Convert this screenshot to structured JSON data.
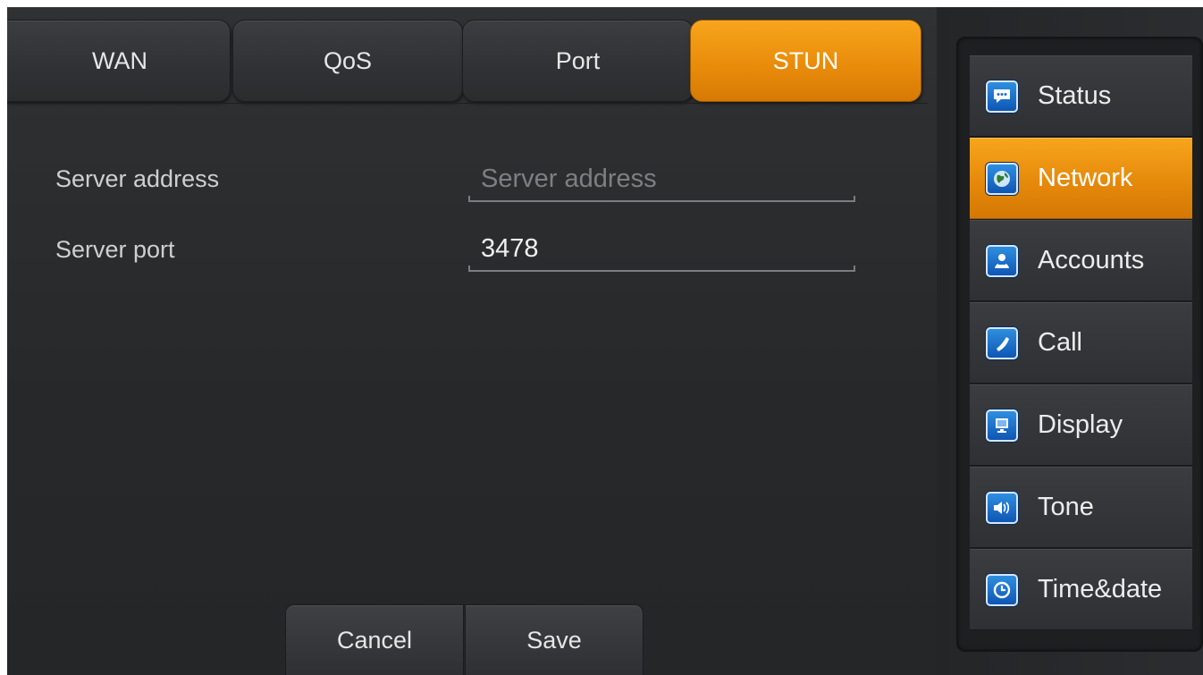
{
  "tabs": [
    {
      "label": "WAN",
      "active": false
    },
    {
      "label": "QoS",
      "active": false
    },
    {
      "label": "Port",
      "active": false
    },
    {
      "label": "STUN",
      "active": true
    }
  ],
  "form": {
    "server_address": {
      "label": "Server address",
      "placeholder": "Server address",
      "value": ""
    },
    "server_port": {
      "label": "Server port",
      "placeholder": "",
      "value": "3478"
    }
  },
  "buttons": {
    "cancel": "Cancel",
    "save": "Save"
  },
  "sidebar": {
    "items": [
      {
        "label": "Status",
        "icon": "chat-bubble-icon",
        "active": false
      },
      {
        "label": "Network",
        "icon": "globe-icon",
        "active": true
      },
      {
        "label": "Accounts",
        "icon": "users-icon",
        "active": false
      },
      {
        "label": "Call",
        "icon": "phone-handset-icon",
        "active": false
      },
      {
        "label": "Display",
        "icon": "monitor-icon",
        "active": false
      },
      {
        "label": "Tone",
        "icon": "speaker-icon",
        "active": false
      },
      {
        "label": "Time&date",
        "icon": "clock-icon",
        "active": false
      }
    ]
  },
  "colors": {
    "accent": "#f29a14",
    "background": "#2a2c2e",
    "icon_blue": "#1a6fcf"
  }
}
